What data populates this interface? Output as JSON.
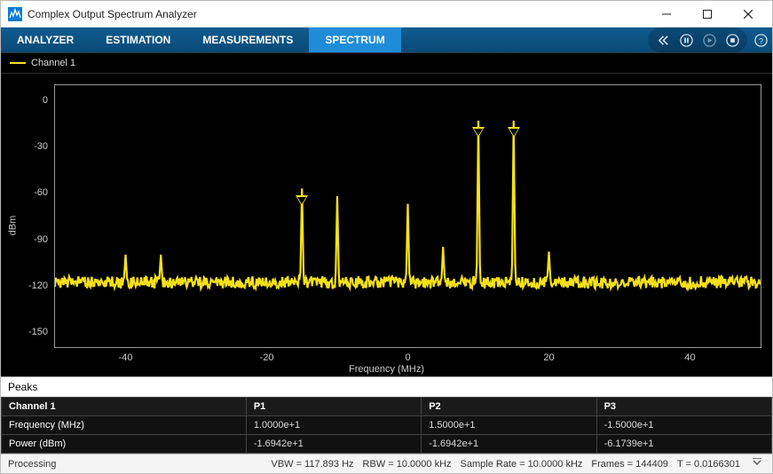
{
  "title": "Complex Output Spectrum Analyzer",
  "tabs": {
    "analyzer": "ANALYZER",
    "estimation": "ESTIMATION",
    "measurements": "MEASUREMENTS",
    "spectrum": "SPECTRUM"
  },
  "active_tab": "spectrum",
  "toolbar_icons": {
    "rewind": "rewind-icon",
    "pause": "pause-icon",
    "play": "play-icon",
    "stop": "stop-icon",
    "help": "help-icon"
  },
  "legend": {
    "channel1": "Channel 1"
  },
  "axes": {
    "ylabel": "dBm",
    "xlabel": "Frequency (MHz)"
  },
  "peaks": {
    "section_title": "Peaks",
    "headers": {
      "ch": "Channel 1",
      "p1": "P1",
      "p2": "P2",
      "p3": "P3"
    },
    "rows": [
      {
        "label": "Frequency (MHz)",
        "p1": "1.0000e+1",
        "p2": "1.5000e+1",
        "p3": "-1.5000e+1"
      },
      {
        "label": "Power (dBm)",
        "p1": "-1.6942e+1",
        "p2": "-1.6942e+1",
        "p3": "-6.1739e+1"
      }
    ]
  },
  "status": {
    "processing": "Processing",
    "vbw": "VBW = 117.893 Hz",
    "rbw": "RBW = 10.0000 kHz",
    "sample_rate": "Sample Rate = 10.0000 kHz",
    "frames": "Frames = 144409",
    "t": "T = 0.0166301"
  },
  "chart_data": {
    "type": "line",
    "title": "",
    "xlabel": "Frequency (MHz)",
    "ylabel": "dBm",
    "xlim": [
      -50,
      50
    ],
    "ylim": [
      -160,
      10
    ],
    "xticks": [
      -40,
      -20,
      0,
      20,
      40
    ],
    "yticks": [
      0,
      -30,
      -60,
      -90,
      -120,
      -150
    ],
    "noise_floor_dbm": -118,
    "noise_jitter_dbm": 4,
    "series": [
      {
        "name": "Channel 1",
        "color": "#f5e01a",
        "peaks_x_mhz": [
          -40,
          -35,
          -15,
          -10,
          0,
          5,
          10,
          15,
          20
        ],
        "peaks_y_dbm": [
          -100,
          -100,
          -57,
          -62,
          -67,
          -95,
          -13,
          -13,
          -98
        ]
      }
    ],
    "markers": [
      {
        "label": "P1",
        "x_mhz": 10,
        "y_dbm": -16.942
      },
      {
        "label": "P2",
        "x_mhz": 15,
        "y_dbm": -16.942
      },
      {
        "label": "P3",
        "x_mhz": -15,
        "y_dbm": -61.739
      }
    ]
  }
}
